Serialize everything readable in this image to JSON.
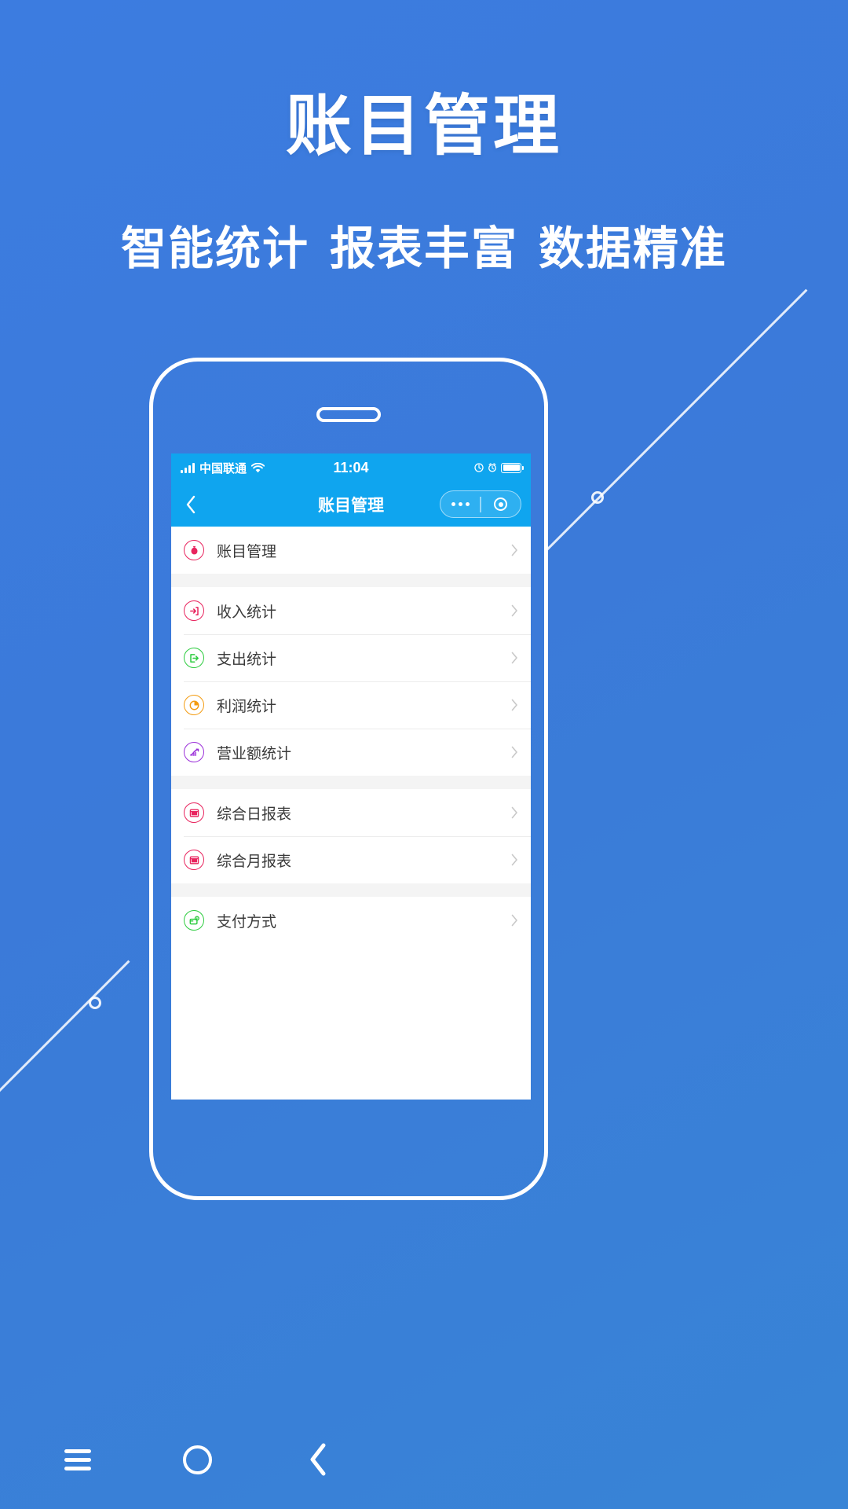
{
  "promo": {
    "headline": "账目管理",
    "subheadline_parts": [
      "智能统计",
      "报表丰富",
      "数据精准"
    ]
  },
  "theme": {
    "background_blue": "#3b7ddd",
    "app_bar_blue": "#0fa5ef",
    "pink": "#e8245e",
    "green": "#2ecc40",
    "orange": "#f39c12",
    "purple": "#9b30d9"
  },
  "phone": {
    "status_bar": {
      "signal_icon": "signal-bars-icon",
      "carrier": "中国联通",
      "wifi_icon": "wifi-icon",
      "time": "11:04",
      "alarm_icon": "alarm-icon",
      "location_icon": "location-icon",
      "battery_icon": "battery-icon"
    },
    "nav_bar": {
      "back_icon": "back-chevron-icon",
      "title": "账目管理",
      "capsule": {
        "more_icon": "more-dots-icon",
        "target_icon": "target-icon"
      }
    },
    "list_groups": [
      {
        "items": [
          {
            "label": "账目管理",
            "icon": "money-bag-icon",
            "color": "#e8245e",
            "glyph": "money-bag",
            "arrow": "chevron-right-icon"
          }
        ]
      },
      {
        "items": [
          {
            "label": "收入统计",
            "icon": "arrow-into-box-icon",
            "color": "#e8245e",
            "glyph": "arrow-in",
            "arrow": "chevron-right-icon"
          },
          {
            "label": "支出统计",
            "icon": "arrow-out-of-box-icon",
            "color": "#2ecc40",
            "glyph": "arrow-out",
            "arrow": "chevron-right-icon"
          },
          {
            "label": "利润统计",
            "icon": "pie-chart-icon",
            "color": "#f39c12",
            "glyph": "pie",
            "arrow": "chevron-right-icon"
          },
          {
            "label": "营业额统计",
            "icon": "trend-chart-icon",
            "color": "#9b30d9",
            "glyph": "trend",
            "arrow": "chevron-right-icon"
          }
        ]
      },
      {
        "items": [
          {
            "label": "综合日报表",
            "icon": "report-window-icon",
            "color": "#e8245e",
            "glyph": "window",
            "arrow": "chevron-right-icon"
          },
          {
            "label": "综合月报表",
            "icon": "report-window-icon",
            "color": "#e8245e",
            "glyph": "window",
            "arrow": "chevron-right-icon"
          }
        ]
      },
      {
        "items": [
          {
            "label": "支付方式",
            "icon": "payment-card-icon",
            "color": "#2ecc40",
            "glyph": "payment",
            "arrow": "chevron-right-icon"
          }
        ]
      }
    ],
    "android_nav": {
      "menu_icon": "menu-hamburger-icon",
      "home_icon": "home-circle-icon",
      "back_icon": "back-chevron-icon"
    }
  }
}
